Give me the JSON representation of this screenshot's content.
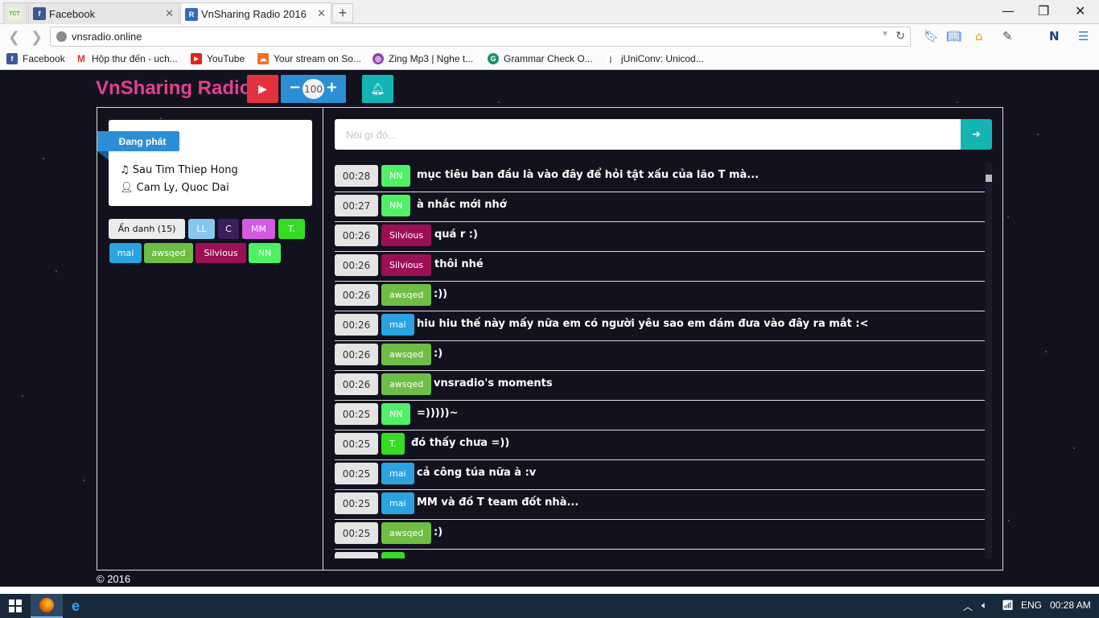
{
  "browser": {
    "tabs": [
      {
        "label": "",
        "favicon": "TCT",
        "color": "#9bd36b"
      },
      {
        "label": "Facebook",
        "favicon": "f",
        "color": "#3b5998"
      },
      {
        "label": "VnSharing Radio 2016",
        "favicon": "R",
        "color": "#2c6fb5"
      }
    ],
    "url": "vnsradio.online",
    "bookmarks": [
      {
        "label": "Facebook",
        "icon": "facebook-icon",
        "color": "#3b5998",
        "glyph": "f"
      },
      {
        "label": "Hộp thư đến - uch...",
        "icon": "gmail-icon",
        "color": "#d93025",
        "glyph": "M"
      },
      {
        "label": "YouTube",
        "icon": "youtube-icon",
        "color": "#e62117",
        "glyph": "▶"
      },
      {
        "label": "Your stream on So...",
        "icon": "soundcloud-icon",
        "color": "#f26f23",
        "glyph": "☁"
      },
      {
        "label": "Zing Mp3 | Nghe t...",
        "icon": "zing-icon",
        "color": "#8e44ad",
        "glyph": "◎"
      },
      {
        "label": "Grammar Check O...",
        "icon": "grammar-icon",
        "color": "#1e8f6b",
        "glyph": "G"
      },
      {
        "label": "jUniConv: Unicod...",
        "icon": "uniconv-icon",
        "color": "#555555",
        "glyph": "j"
      }
    ]
  },
  "site": {
    "brand": "VnSharing Radio",
    "volume": "100",
    "now_playing_label": "Đang phát",
    "song": "Sau Tim Thiep Hong",
    "artist": "Cam Ly, Quoc Dai",
    "users": [
      {
        "name": "Ẩn danh (15)",
        "color": "#ececec",
        "text": "#111111"
      },
      {
        "name": "LL",
        "color": "#86c7f0",
        "text": "#ffffff"
      },
      {
        "name": "C",
        "color": "#3a1f5c",
        "text": "#ffffff"
      },
      {
        "name": "MM",
        "color": "#d45be0",
        "text": "#ffffff"
      },
      {
        "name": "T.",
        "color": "#35dd22",
        "text": "#ffffff"
      },
      {
        "name": "mai",
        "color": "#2aa3e0",
        "text": "#ffffff"
      },
      {
        "name": "awsqed",
        "color": "#6ebd45",
        "text": "#ffffff"
      },
      {
        "name": "Silvious",
        "color": "#9b1055",
        "text": "#ffffff"
      },
      {
        "name": "NN",
        "color": "#4fef66",
        "text": "#ffffff"
      }
    ],
    "chat_placeholder": "Nói gì đó...",
    "messages": [
      {
        "time": "00:28",
        "nick": "NN",
        "color": "#4fef66",
        "text": "mục tiêu ban đầu là vào đây để hỏi tật xấu của lão T mà..."
      },
      {
        "time": "00:27",
        "nick": "NN",
        "color": "#4fef66",
        "text": "à nhắc mới nhớ"
      },
      {
        "time": "00:26",
        "nick": "Silvious",
        "color": "#9b1055",
        "text": "quá r :)"
      },
      {
        "time": "00:26",
        "nick": "Silvious",
        "color": "#9b1055",
        "text": "thôi nhé"
      },
      {
        "time": "00:26",
        "nick": "awsqed",
        "color": "#6ebd45",
        "text": ":))"
      },
      {
        "time": "00:26",
        "nick": "mai",
        "color": "#2aa3e0",
        "text": "hiu hiu thế này mấy nữa em có người yêu sao em dám đưa vào đây ra mắt :<"
      },
      {
        "time": "00:26",
        "nick": "awsqed",
        "color": "#6ebd45",
        "text": ":)"
      },
      {
        "time": "00:26",
        "nick": "awsqed",
        "color": "#6ebd45",
        "text": "vnsradio's moments"
      },
      {
        "time": "00:25",
        "nick": "NN",
        "color": "#4fef66",
        "text": "=)))))~"
      },
      {
        "time": "00:25",
        "nick": "T.",
        "color": "#35dd22",
        "text": "đó thấy chưa =))"
      },
      {
        "time": "00:25",
        "nick": "mai",
        "color": "#2aa3e0",
        "text": "cả công túa nữa à :v"
      },
      {
        "time": "00:25",
        "nick": "mai",
        "color": "#2aa3e0",
        "text": "MM và đồ T team đốt nhà..."
      },
      {
        "time": "00:25",
        "nick": "awsqed",
        "color": "#6ebd45",
        "text": ":)"
      },
      {
        "time": "00:25",
        "nick": "T.",
        "color": "#35dd22",
        "text": ""
      }
    ],
    "footer": "© 2016"
  },
  "taskbar": {
    "language": "ENG",
    "clock": "00:28 AM"
  }
}
